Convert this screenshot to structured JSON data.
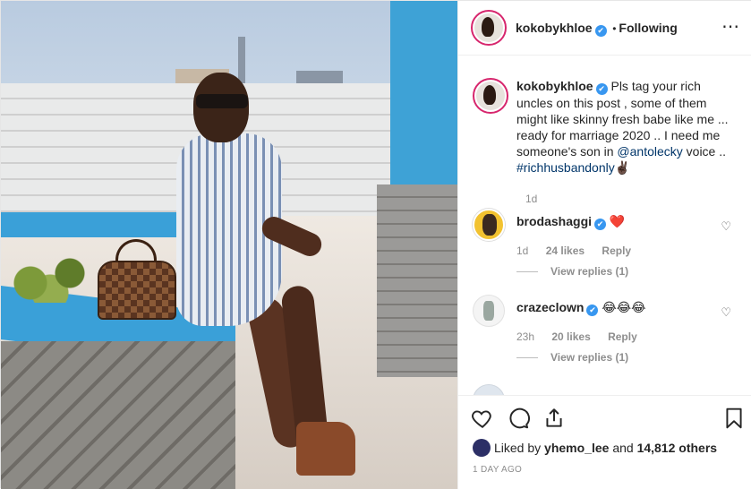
{
  "header": {
    "username": "kokobykhloe",
    "verified_glyph": "✔",
    "separator": "•",
    "follow_status": "Following",
    "more_icon": "⋯"
  },
  "caption": {
    "username": "kokobykhloe",
    "text_before_mention": "Pls tag your rich uncles on this post , some of them might like skinny fresh babe like me ... ready for marriage 2020 .. I need me someone's son in ",
    "mention": "@antolecky",
    "text_after_mention": " voice .. ",
    "hashtag": "#richhusbandonly",
    "emoji": "✌🏿",
    "time": "1d"
  },
  "comments": [
    {
      "username": "brodashaggi",
      "text": "❤️",
      "time": "1d",
      "likes": "24 likes",
      "reply": "Reply",
      "view_replies": "View replies (1)"
    },
    {
      "username": "crazeclown",
      "text": "😂😂😂",
      "time": "23h",
      "likes": "20 likes",
      "reply": "Reply",
      "view_replies": "View replies (1)"
    }
  ],
  "footer": {
    "liked_by_prefix": "Liked by",
    "liked_by_user": "yhemo_lee",
    "liked_by_and": "and",
    "liked_by_others": "14,812 others",
    "time_ago": "1 DAY AGO"
  },
  "colors": {
    "link": "#003569",
    "verified": "#3897f0",
    "story_ring": "#d7266d",
    "muted": "#8e8e8e"
  },
  "icons": [
    "heart-icon",
    "comment-icon",
    "share-icon",
    "bookmark-icon",
    "small-heart-icon",
    "more-options-icon"
  ]
}
